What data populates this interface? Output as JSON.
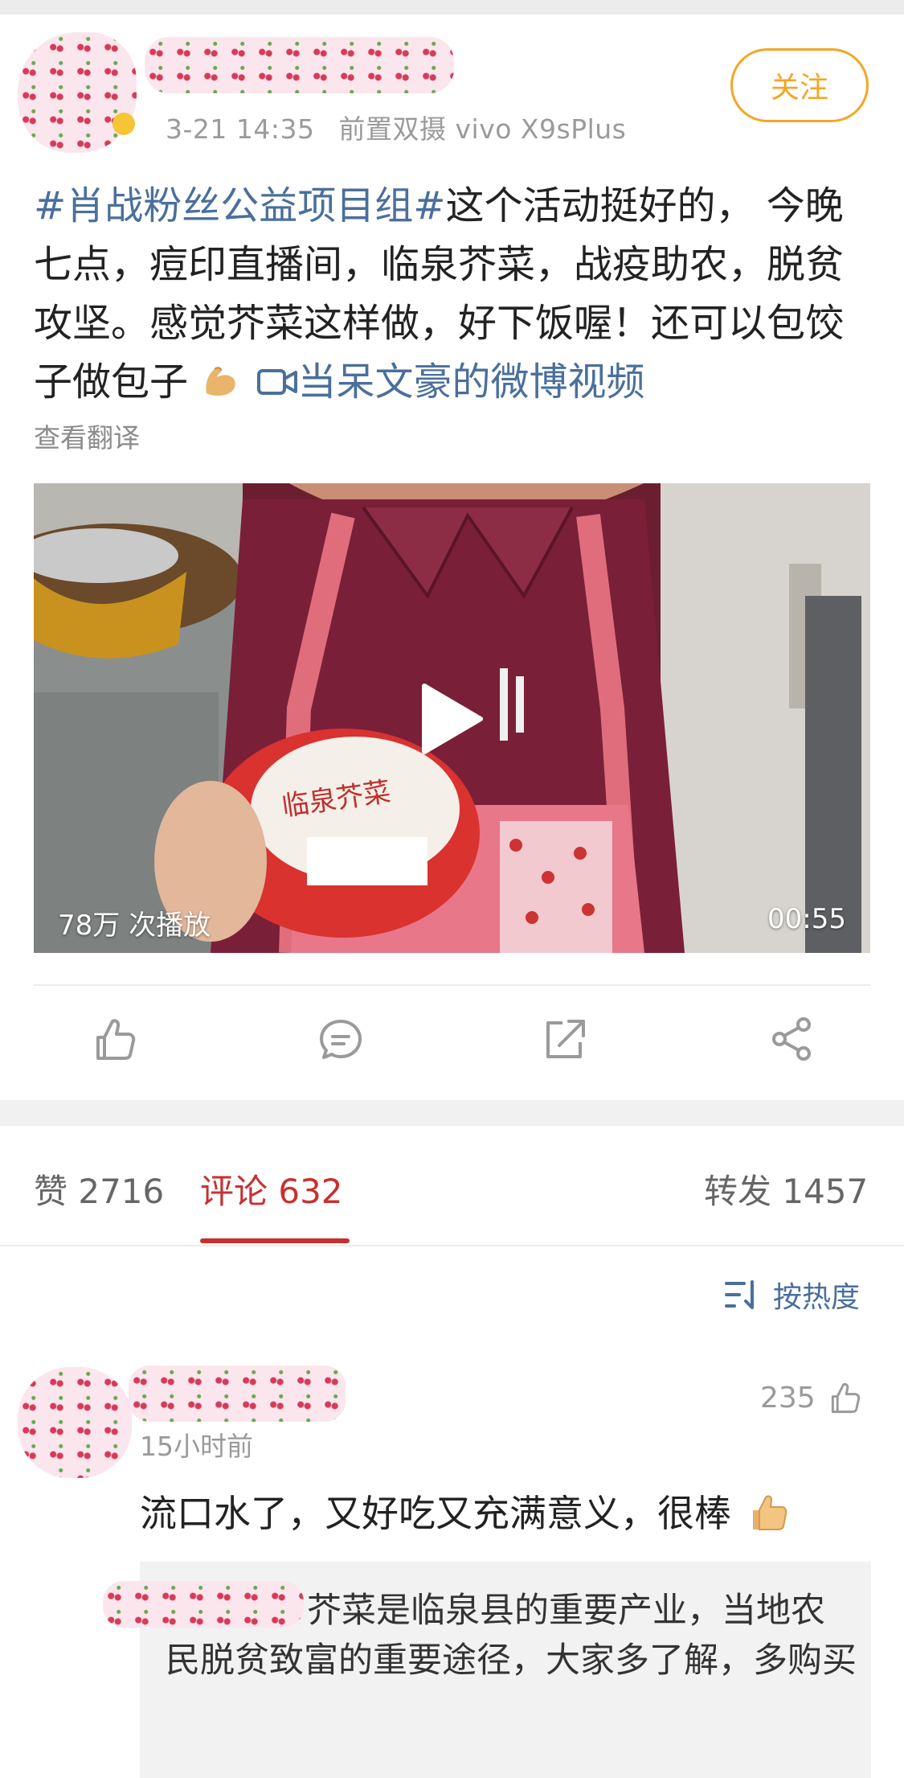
{
  "post": {
    "timestamp": "3-21 14:35",
    "device": "前置双摄 vivo X9sPlus",
    "follow_label": "关注",
    "hashtag": "#肖战粉丝公益项目组#",
    "body": "这个活动挺好的， 今晚七点，痘印直播间，临泉芥菜，战疫助农，脱贫攻坚。感觉芥菜这样做，好下饭喔！还可以包饺子做包子",
    "video_link": "当呆文豪的微博视频",
    "translate_label": "查看翻译",
    "video": {
      "plays": "78万 次播放",
      "duration": "00:55",
      "jar_label": "临泉芥菜"
    }
  },
  "actions": {
    "like": "like-icon",
    "comment": "comment-icon",
    "repost": "repost-icon",
    "share": "share-icon"
  },
  "tabs": {
    "likes": "赞 2716",
    "comments": "评论 632",
    "reposts": "转发 1457"
  },
  "sort_label": "按热度",
  "comment": {
    "likes": "235",
    "time": "15小时前",
    "text": "流口水了，又好吃又充满意义，很棒",
    "reply": "芥菜是临泉县的重要产业，当地农民脱贫致富的重要途径，大家多了解，多购买"
  },
  "colors": {
    "link": "#4a6f9c",
    "accent_red": "#c8302f",
    "follow_orange": "#f5a623"
  }
}
